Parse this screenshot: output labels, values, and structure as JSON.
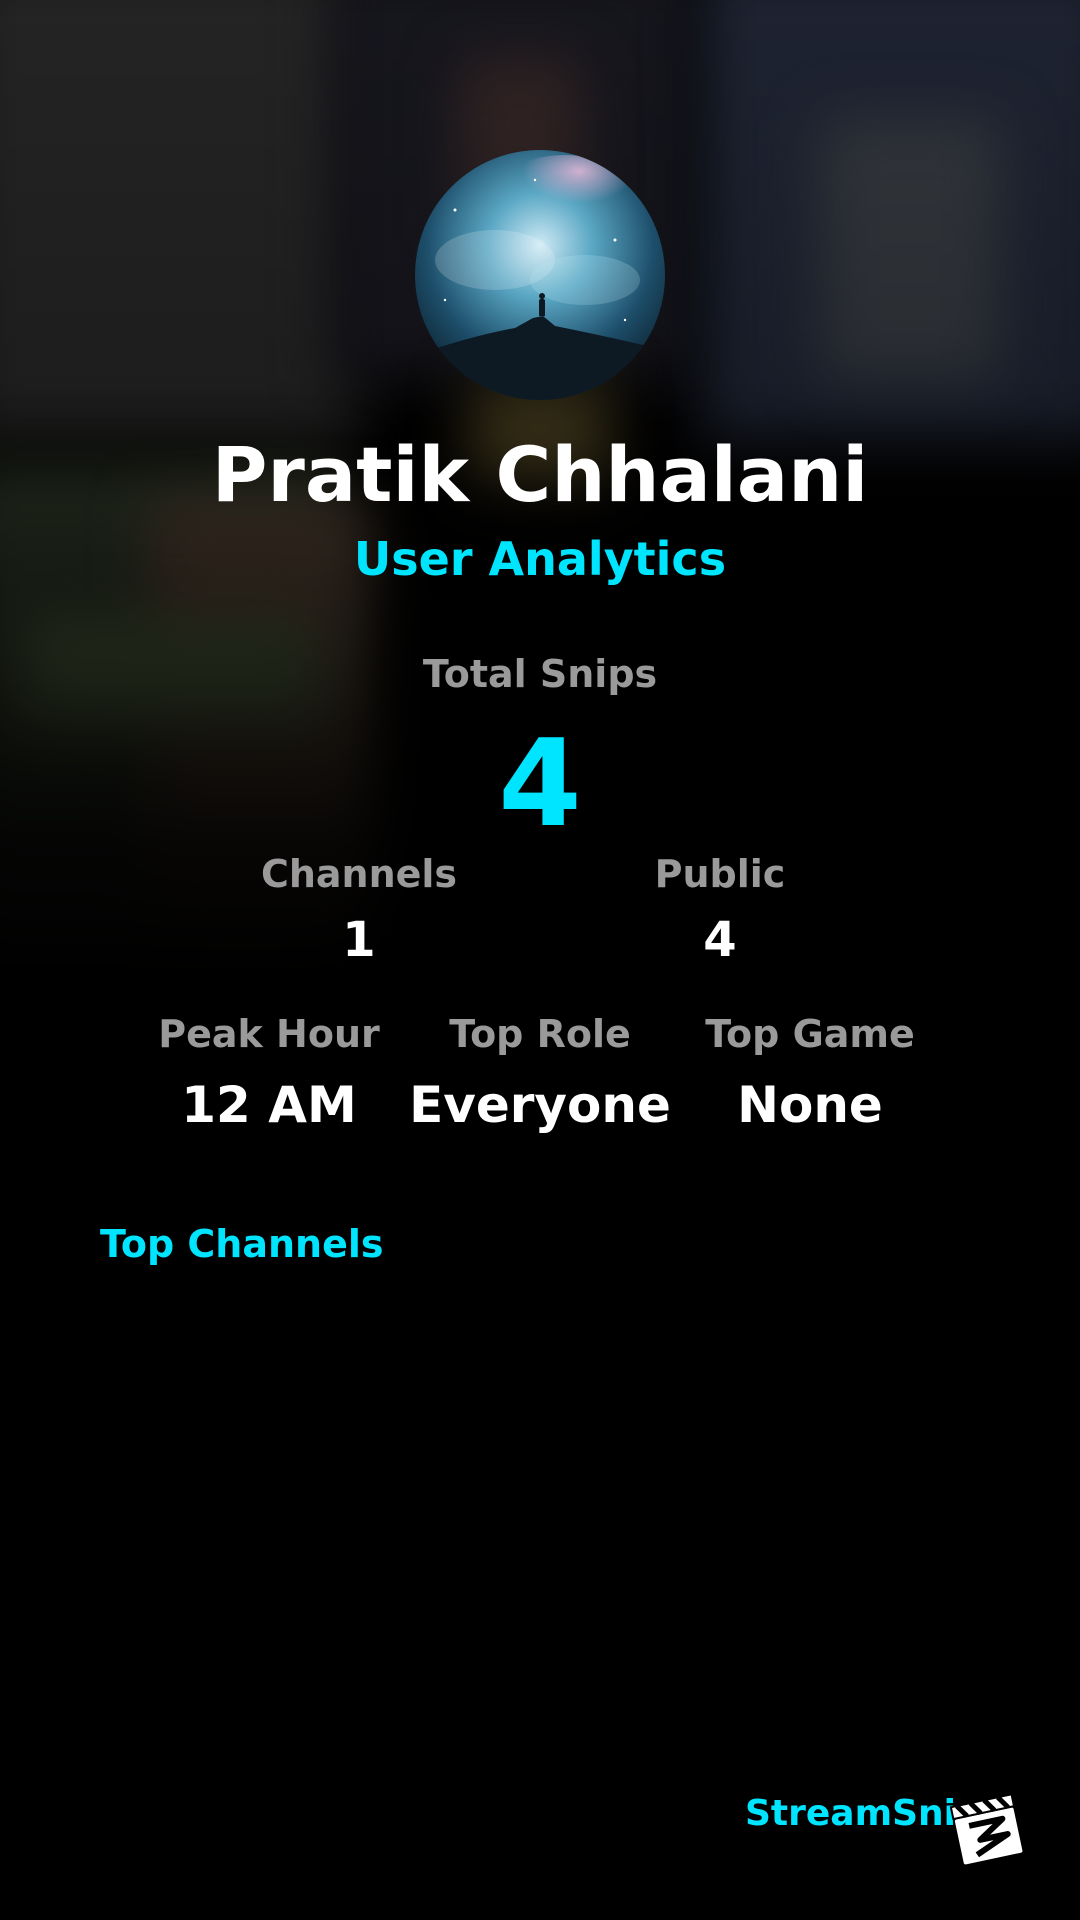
{
  "profile": {
    "name": "Pratik Chhalani",
    "subtitle": "User Analytics"
  },
  "stats": {
    "total_label": "Total Snips",
    "total_value": "4",
    "channels_label": "Channels",
    "channels_value": "1",
    "public_label": "Public",
    "public_value": "4",
    "peak_label": "Peak Hour",
    "peak_value": "12 AM",
    "role_label": "Top Role",
    "role_value": "Everyone",
    "game_label": "Top Game",
    "game_value": "None"
  },
  "sections": {
    "top_channels": "Top Channels"
  },
  "brand": {
    "name": "StreamSnip"
  },
  "colors": {
    "accent": "#00e5ff",
    "background": "#000000",
    "label": "#9a9a9a"
  },
  "icons": {
    "avatar": "galaxy-avatar",
    "logo": "clapperboard-logo-icon"
  }
}
